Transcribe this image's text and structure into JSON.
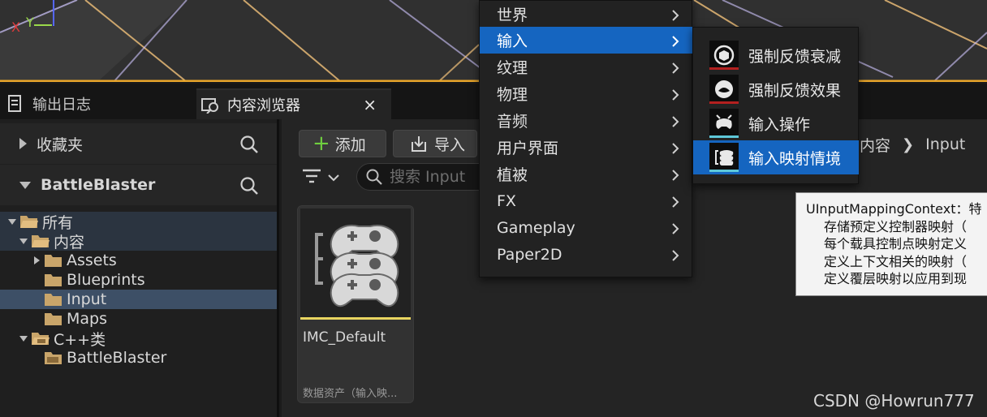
{
  "viewport": {
    "axis_x": "X",
    "axis_y": "Y"
  },
  "tabs": [
    {
      "label": "输出日志"
    },
    {
      "label": "内容浏览器",
      "close": "×"
    }
  ],
  "left_panel": {
    "favorites": "收藏夹",
    "project": "BattleBlaster",
    "tree": [
      {
        "label": "所有"
      },
      {
        "label": "内容"
      },
      {
        "label": "Assets"
      },
      {
        "label": "Blueprints"
      },
      {
        "label": "Input"
      },
      {
        "label": "Maps"
      },
      {
        "label": "C++类"
      },
      {
        "label": "BattleBlaster"
      }
    ]
  },
  "toolbar": {
    "add_label": "添加",
    "import_label": "导入",
    "search_placeholder": "搜索 Input",
    "breadcrumb": [
      "内容",
      "Input"
    ]
  },
  "asset": {
    "name": "IMC_Default",
    "type": "数据资产（输入映..."
  },
  "menu": {
    "items": [
      {
        "label": "世界"
      },
      {
        "label": "输入"
      },
      {
        "label": "纹理"
      },
      {
        "label": "物理"
      },
      {
        "label": "音频"
      },
      {
        "label": "用户界面"
      },
      {
        "label": "植被"
      },
      {
        "label": "FX"
      },
      {
        "label": "Gameplay"
      },
      {
        "label": "Paper2D"
      }
    ],
    "highlight_color": "#1565c0"
  },
  "submenu": {
    "items": [
      {
        "label": "强制反馈衰减",
        "icon": "force-feedback-attenuation-icon",
        "stripe": "#b3201f"
      },
      {
        "label": "强制反馈效果",
        "icon": "force-feedback-effect-icon",
        "stripe": "#b3201f"
      },
      {
        "label": "输入操作",
        "icon": "input-action-icon",
        "stripe": "#5ec8d8"
      },
      {
        "label": "输入映射情境",
        "icon": "input-mapping-context-icon",
        "stripe": "#5ec8d8"
      }
    ]
  },
  "tooltip": {
    "lines": [
      "UInputMappingContext：特",
      "存储预定义控制器映射（",
      "每个载具控制点映射定义",
      "定义上下文相关的映射（",
      "定义覆层映射以应用到现"
    ]
  },
  "watermark": "CSDN @Howrun777",
  "colors": {
    "selection": "#3d4f66",
    "asset_bar": "#e8d560",
    "folder": "#c9a56a"
  }
}
